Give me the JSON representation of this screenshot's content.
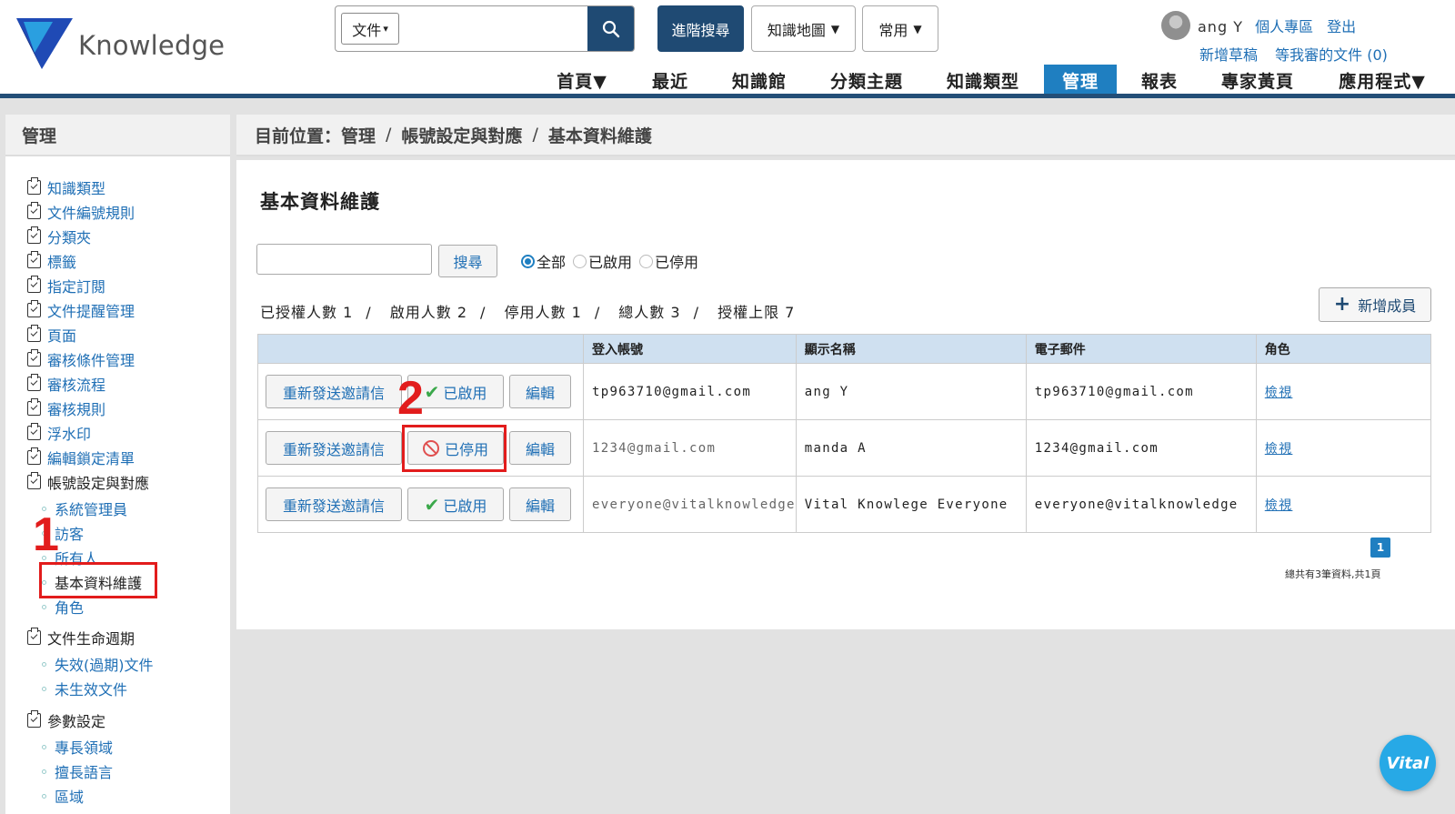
{
  "header": {
    "logo_text": "Knowledge",
    "search_type": "文件",
    "search_value": "",
    "advanced_search": "進階搜尋",
    "knowledge_map": "知識地圖",
    "common": "常用",
    "user_name": "ang Y",
    "personal_area": "個人專區",
    "logout": "登出",
    "new_draft": "新增草稿",
    "pending_review": "等我審的文件 (0)"
  },
  "nav": {
    "items": [
      "首頁▼",
      "最近",
      "知識館",
      "分類主題",
      "知識類型",
      "管理",
      "報表",
      "專家黃頁",
      "應用程式▼"
    ],
    "active": "管理"
  },
  "sidebar": {
    "title": "管理",
    "items": [
      "知識類型",
      "文件編號規則",
      "分類夾",
      "標籤",
      "指定訂閱",
      "文件提醒管理",
      "頁面",
      "審核條件管理",
      "審核流程",
      "審核規則",
      "浮水印",
      "編輯鎖定清單"
    ],
    "account_group": "帳號設定與對應",
    "account_subitems": [
      "系統管理員",
      "訪客",
      "所有人",
      "基本資料維護",
      "角色"
    ],
    "lifecycle_group": "文件生命週期",
    "lifecycle_subitems": [
      "失效(過期)文件",
      "未生效文件"
    ],
    "params_group": "參數設定",
    "params_subitems": [
      "專長領域",
      "擅長語言",
      "區域"
    ]
  },
  "annotations": {
    "step1": "1",
    "step2": "2"
  },
  "breadcrumb": {
    "prefix": "目前位置：管理",
    "level2": "帳號設定與對應",
    "level3": "基本資料維護",
    "sep": "/"
  },
  "page": {
    "title": "基本資料維護",
    "search_button": "搜尋",
    "filter_all": "全部",
    "filter_enabled": "已啟用",
    "filter_disabled": "已停用",
    "stats": {
      "authorized": "已授權人數 1",
      "enabled": "啟用人數 2",
      "disabled": "停用人數 1",
      "total": "總人數 3",
      "limit": "授權上限 7"
    },
    "add_member": "新增成員",
    "columns": {
      "actions": "",
      "login": "登入帳號",
      "display_name": "顯示名稱",
      "email": "電子郵件",
      "role": "角色"
    },
    "rows": [
      {
        "resend": "重新發送邀請信",
        "status": "已啟用",
        "status_type": "enabled",
        "edit": "編輯",
        "login": "tp963710@gmail.com",
        "name": "ang Y",
        "email": "tp963710@gmail.com",
        "role": "檢視"
      },
      {
        "resend": "重新發送邀請信",
        "status": "已停用",
        "status_type": "disabled",
        "edit": "編輯",
        "login": "1234@gmail.com",
        "name": "manda A",
        "email": "1234@gmail.com",
        "role": "檢視"
      },
      {
        "resend": "重新發送邀請信",
        "status": "已啟用",
        "status_type": "enabled",
        "edit": "編輯",
        "login": "everyone@vitalknowledge",
        "name": "Vital Knowlege Everyone",
        "email": "everyone@vitalknowledge",
        "role": "檢視"
      }
    ],
    "pagination": {
      "current": "1",
      "summary": "總共有3筆資料,共1頁"
    }
  },
  "badge": {
    "label": "Vital"
  },
  "colors": {
    "brand_dark": "#1f4a73",
    "active_tab": "#1f7fc1",
    "highlight": "#e21c1c"
  }
}
